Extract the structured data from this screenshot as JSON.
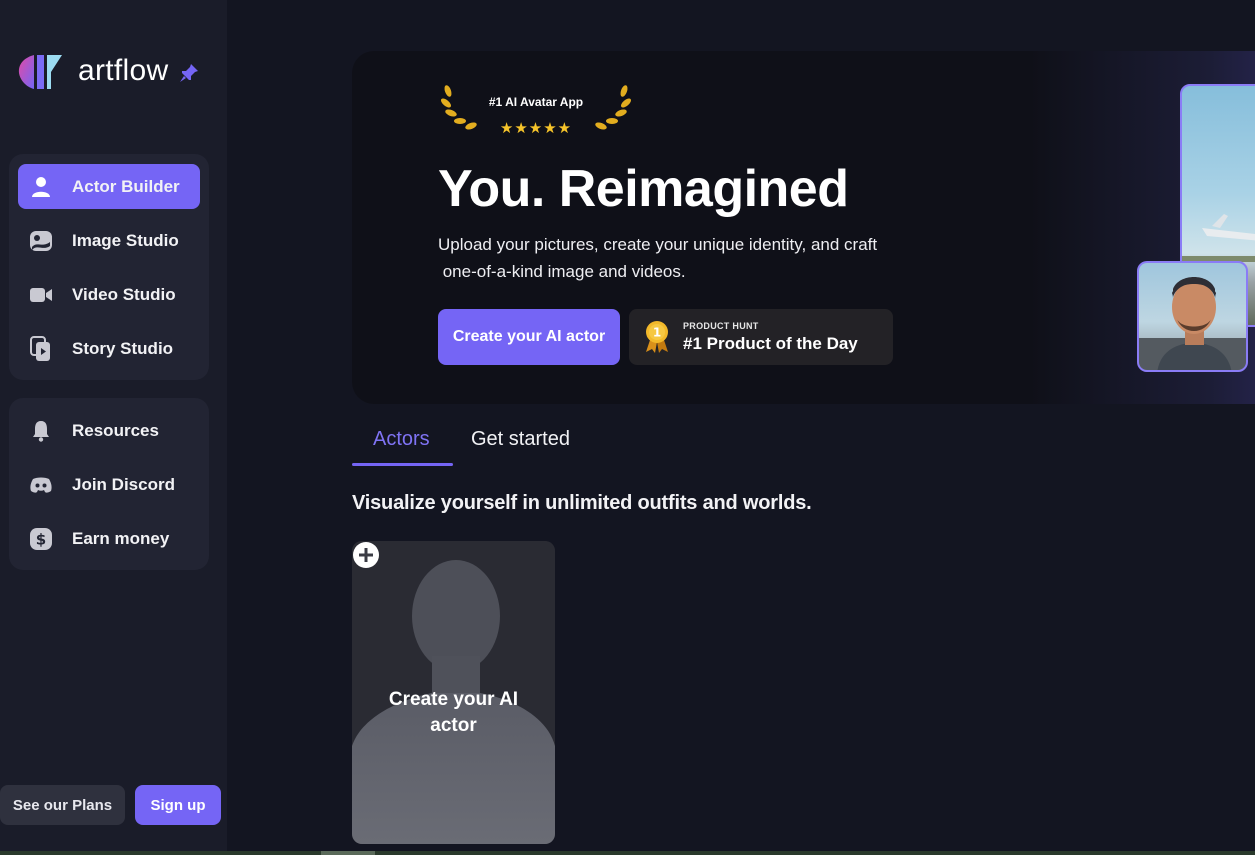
{
  "brand": {
    "name": "artflow",
    "accent": "#7565f5"
  },
  "sidebar": {
    "primary": [
      {
        "label": "Actor Builder",
        "icon": "user-icon",
        "active": true
      },
      {
        "label": "Image Studio",
        "icon": "image-icon",
        "active": false
      },
      {
        "label": "Video Studio",
        "icon": "video-camera-icon",
        "active": false
      },
      {
        "label": "Story Studio",
        "icon": "story-icon",
        "active": false
      }
    ],
    "secondary": [
      {
        "label": "Resources",
        "icon": "bell-icon"
      },
      {
        "label": "Join Discord",
        "icon": "discord-icon"
      },
      {
        "label": "Earn money",
        "icon": "dollar-icon"
      }
    ],
    "plans_label": "See our Plans",
    "signup_label": "Sign up"
  },
  "hero": {
    "award_text": "#1 AI Avatar App",
    "stars": "★★★★★",
    "title": "You. Reimagined",
    "subtitle_line1": "Upload your pictures, create your unique identity, and craft",
    "subtitle_line2": " one-of-a-kind image and videos.",
    "cta_label": "Create your AI actor",
    "badge_small": "PRODUCT HUNT",
    "badge_big": "#1 Product of the Day",
    "medal_number": "1"
  },
  "tabs": [
    {
      "label": "Actors",
      "active": true
    },
    {
      "label": "Get started",
      "active": false
    }
  ],
  "section_title": "Visualize yourself in unlimited outfits and worlds.",
  "actor_card": {
    "label_line1": "Create your AI",
    "label_line2": "actor"
  }
}
